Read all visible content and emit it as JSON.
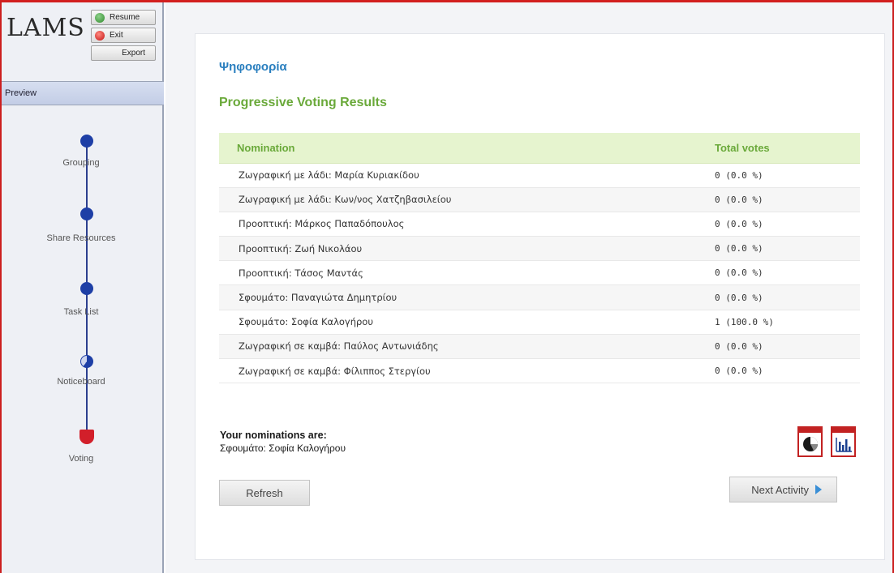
{
  "app": {
    "logo": "LAMS",
    "controls": {
      "resume": "Resume",
      "exit": "Exit",
      "export": "Export"
    },
    "preview_label": "Preview"
  },
  "sequence": {
    "steps": [
      {
        "label": "Grouping",
        "state": "complete"
      },
      {
        "label": "Share Resources",
        "state": "complete"
      },
      {
        "label": "Task List",
        "state": "complete"
      },
      {
        "label": "Noticeboard",
        "state": "partial"
      },
      {
        "label": "Voting",
        "state": "current"
      }
    ]
  },
  "activity": {
    "title": "Ψηφοφορία",
    "results_title": "Progressive Voting Results",
    "table": {
      "headers": {
        "nomination": "Nomination",
        "votes": "Total votes"
      },
      "rows": [
        {
          "nomination": "Ζωγραφική με λάδι: Μαρία Κυριακίδου",
          "votes": "0 (0.0 %)"
        },
        {
          "nomination": "Ζωγραφική με λάδι: Κων/νος Χατζηβασιλείου",
          "votes": "0 (0.0 %)"
        },
        {
          "nomination": "Προοπτική: Μάρκος Παπαδόπουλος",
          "votes": "0 (0.0 %)"
        },
        {
          "nomination": "Προοπτική: Ζωή Νικολάου",
          "votes": "0 (0.0 %)"
        },
        {
          "nomination": "Προοπτική: Τάσος Μαντάς",
          "votes": "0 (0.0 %)"
        },
        {
          "nomination": "Σφουμάτο: Παναγιώτα Δημητρίου",
          "votes": "0 (0.0 %)"
        },
        {
          "nomination": "Σφουμάτο: Σοφία Καλογήρου",
          "votes": "1 (100.0 %)"
        },
        {
          "nomination": "Ζωγραφική σε καμβά: Παύλος Αντωνιάδης",
          "votes": "0 (0.0 %)"
        },
        {
          "nomination": "Ζωγραφική σε καμβά: Φίλιππος Στεργίου",
          "votes": "0 (0.0 %)"
        }
      ]
    },
    "your_nominations_label": "Your nominations are:",
    "your_nominations_value": "Σφουμάτο: Σοφία Καλογήρου",
    "icons": {
      "pie_chart": "pie-chart-icon",
      "bar_chart": "bar-chart-icon"
    },
    "buttons": {
      "refresh": "Refresh",
      "next": "Next Activity"
    }
  },
  "colors": {
    "frame_red": "#d21f1f",
    "title_blue": "#2a7fbf",
    "results_green": "#6aa93a",
    "header_green_bg": "#e6f4cf",
    "step_blue": "#1e3fa6",
    "current_red": "#d21f2a"
  }
}
